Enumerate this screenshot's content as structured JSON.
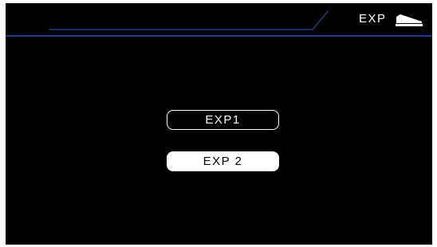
{
  "header": {
    "title": "EXP",
    "icon": "expression-pedal-icon"
  },
  "menu": {
    "items": [
      {
        "label": "EXP1",
        "selected": false
      },
      {
        "label": "EXP 2",
        "selected": true
      }
    ]
  },
  "colors": {
    "background": "#000000",
    "accent_line": "#1f3a8c",
    "text": "#ffffff",
    "selected_bg": "#ffffff",
    "selected_text": "#000000"
  }
}
